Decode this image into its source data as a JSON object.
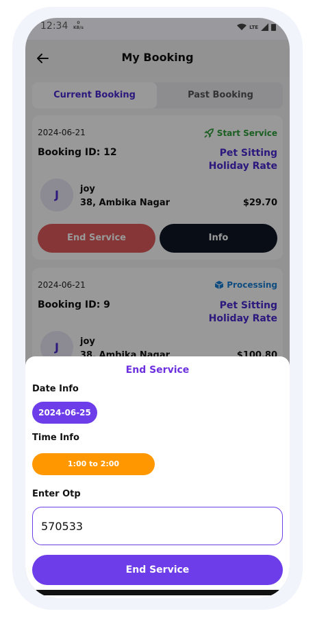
{
  "status_bar": {
    "time": "12:34",
    "speed_value": "0",
    "speed_unit": "KB/s",
    "network": "LTE"
  },
  "header": {
    "title": "My Booking"
  },
  "tabs": [
    {
      "label": "Current Booking",
      "active": true
    },
    {
      "label": "Past Booking",
      "active": false
    }
  ],
  "bookings": [
    {
      "date": "2024-06-21",
      "status": "Start Service",
      "status_color": "#2e9e3a",
      "booking_id": "Booking ID: 12",
      "service": "Pet Sitting",
      "rate": "Holiday Rate",
      "avatar_letter": "J",
      "customer_name": "joy",
      "address": "38, Ambika Nagar",
      "price": "$29.70",
      "end_label": "End Service",
      "info_label": "Info"
    },
    {
      "date": "2024-06-21",
      "status": "Processing",
      "status_color": "#1a7fd6",
      "booking_id": "Booking ID: 9",
      "service": "Pet Sitting",
      "rate": "Holiday Rate",
      "avatar_letter": "J",
      "customer_name": "joy",
      "address": "38, Ambika Nagar",
      "price": "$100.80"
    }
  ],
  "sheet": {
    "title": "End Service",
    "date_label": "Date Info",
    "date_value": "2024-06-25",
    "time_label": "Time Info",
    "time_value": "1:00 to 2:00",
    "otp_label": "Enter Otp",
    "otp_value": "570533",
    "submit_label": "End Service"
  },
  "colors": {
    "accent": "#6c3de8",
    "accent_text": "#4b2bd0",
    "time_pill": "#ff9800",
    "danger": "#e05a5a",
    "dark": "#101626"
  }
}
